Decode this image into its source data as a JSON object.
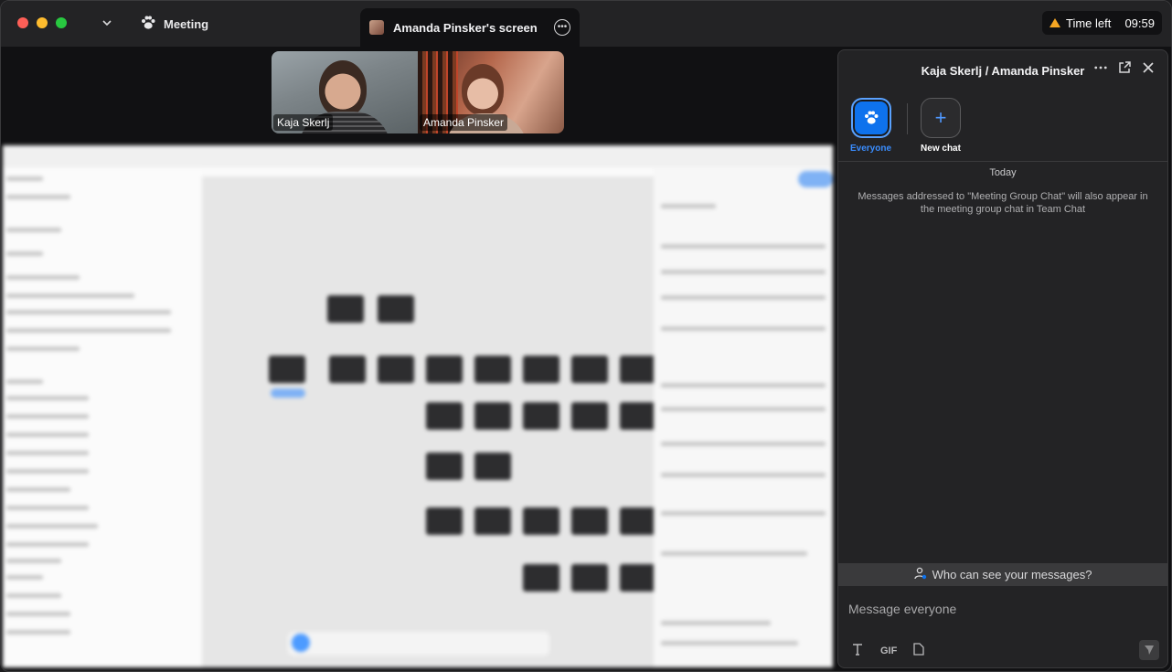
{
  "titlebar": {
    "app_title": "Meeting",
    "tab_title": "Amanda Pinsker's screen",
    "time_left_label": "Time left",
    "time_left_value": "09:59"
  },
  "videos": [
    {
      "name": "Kaja Skerlj"
    },
    {
      "name": "Amanda Pinsker"
    }
  ],
  "chat": {
    "header_title": "Kaja Skerlj / Amanda Pinsker",
    "recipients": [
      {
        "label": "Everyone",
        "icon": "meeting-group-icon",
        "selected": true
      },
      {
        "label": "New chat",
        "icon": "plus-icon",
        "selected": false
      }
    ],
    "date_separator": "Today",
    "notice": "Messages addressed to \"Meeting Group Chat\" will also appear in the meeting group chat in Team Chat",
    "who_can_see": "Who can see your messages?",
    "input_placeholder": "Message everyone",
    "toolbar": {
      "gif_label": "GIF"
    }
  },
  "colors": {
    "accent": "#0e72ed",
    "warning": "#f5a623",
    "panel_bg": "#232325"
  }
}
